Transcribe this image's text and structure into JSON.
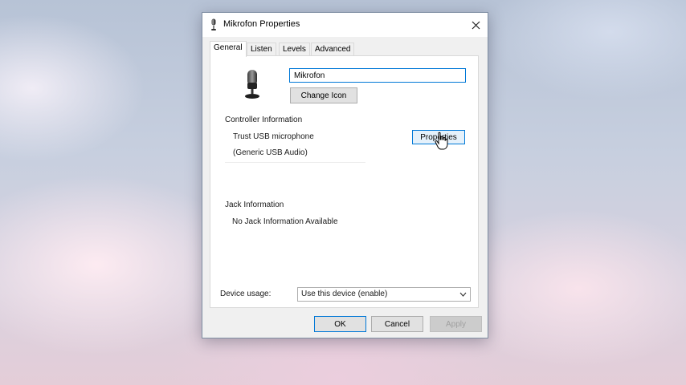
{
  "window": {
    "title": "Mikrofon Properties",
    "title_icon": "microphone-icon",
    "close_icon": "close-icon"
  },
  "tabs": [
    {
      "label": "General",
      "active": true
    },
    {
      "label": "Listen",
      "active": false
    },
    {
      "label": "Levels",
      "active": false
    },
    {
      "label": "Advanced",
      "active": false
    }
  ],
  "general": {
    "device_icon": "microphone-icon",
    "device_name": "Mikrofon",
    "change_icon_label": "Change Icon",
    "controller_heading": "Controller Information",
    "controller_name": "Trust USB microphone",
    "controller_driver": "(Generic USB Audio)",
    "controller_properties_label": "Properties",
    "jack_heading": "Jack Information",
    "jack_text": "No Jack Information Available"
  },
  "device_usage": {
    "label": "Device usage:",
    "selected": "Use this device (enable)"
  },
  "footer": {
    "ok_label": "OK",
    "cancel_label": "Cancel",
    "apply_label": "Apply"
  },
  "colors": {
    "accent": "#0078d7",
    "button_bg": "#e1e1e1",
    "focused_bg": "#e5f1fb"
  }
}
